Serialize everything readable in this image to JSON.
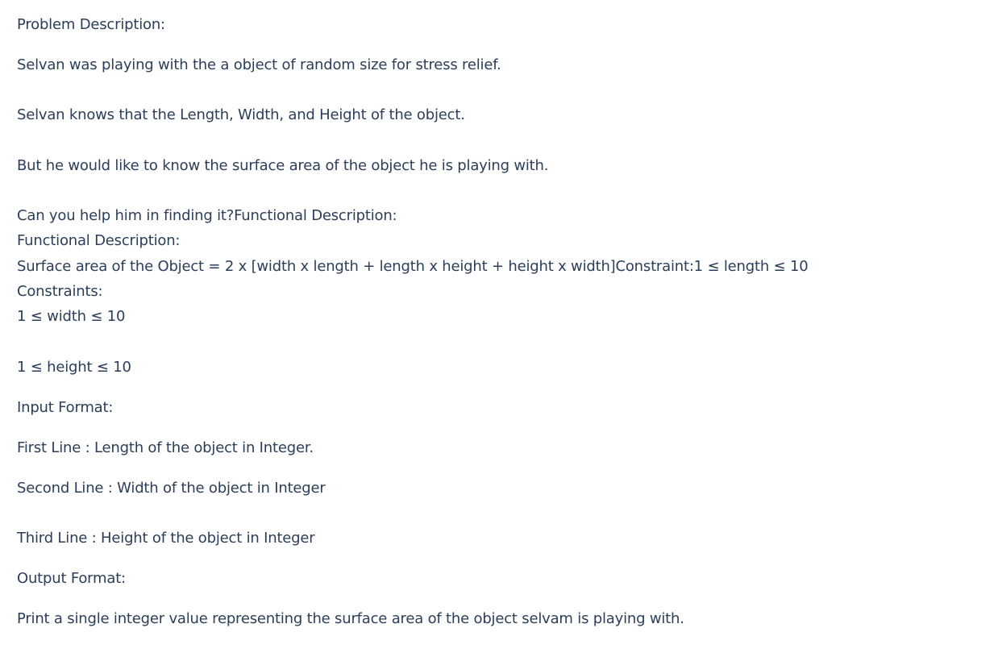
{
  "problem": {
    "heading": "Problem Description:",
    "para1": "Selvan was playing with the a object of random size for stress relief.",
    "para2": "Selvan knows that the Length, Width, and Height of the object.",
    "para3": "But he would like to know the surface area of the object he is playing with.",
    "para4": "Can you help him in finding it?Functional Description:"
  },
  "functional": {
    "heading": "Functional Description:",
    "formula": "Surface area of the Object = 2 x [width x length + length x height + height x width]Constraint:1 ≤ length ≤ 10"
  },
  "constraints": {
    "heading": "Constraints:",
    "width": "1 ≤ width ≤ 10",
    "height": "1 ≤ height ≤ 10"
  },
  "input_format": {
    "heading": "Input Format:",
    "line1": "First Line : Length of the object in Integer.",
    "line2": "Second Line : Width of the object in Integer",
    "line3": "Third Line : Height of the object in Integer"
  },
  "output_format": {
    "heading": "Output Format:",
    "line1": "Print a single integer value representing the surface area of the object selvam is playing with."
  }
}
